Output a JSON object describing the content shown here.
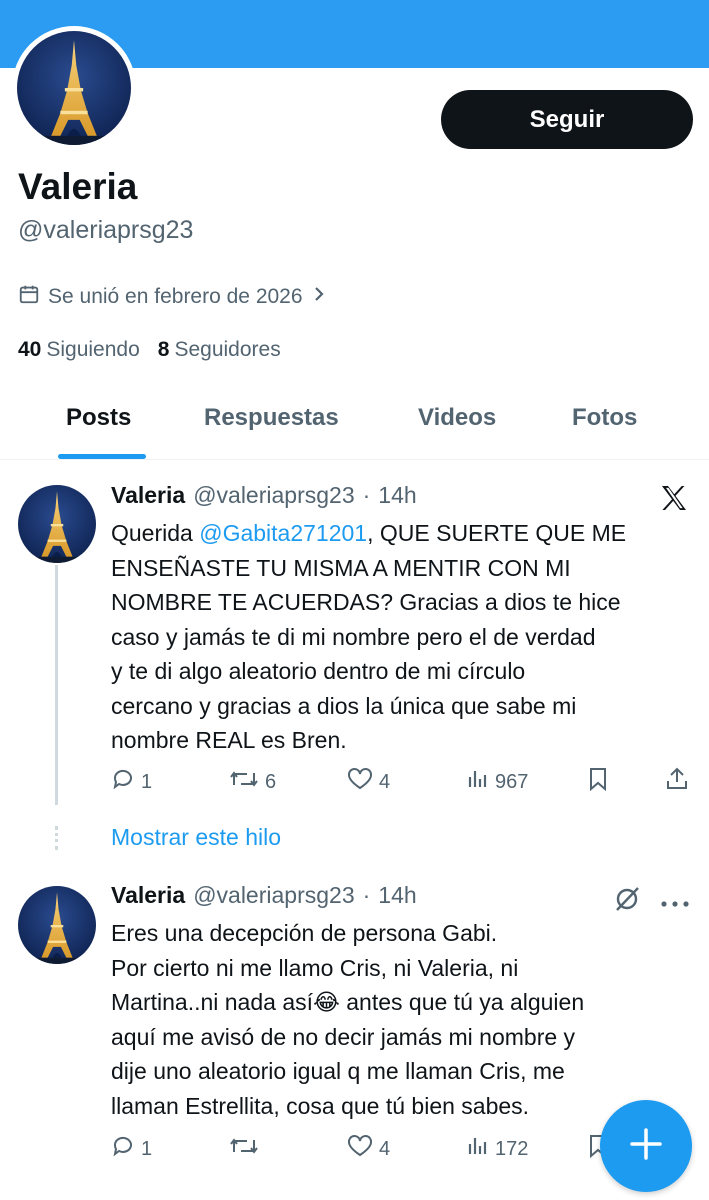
{
  "profile": {
    "name": "Valeria",
    "handle": "@valeriaprsg23",
    "joined": "Se unió en febrero de 2026",
    "following_count": "40",
    "following_label": "Siguiendo",
    "followers_count": "8",
    "followers_label": "Seguidores",
    "follow_button": "Seguir"
  },
  "tabs": [
    {
      "label": "Posts"
    },
    {
      "label": "Respuestas"
    },
    {
      "label": "Videos"
    },
    {
      "label": "Fotos"
    }
  ],
  "posts": [
    {
      "name": "Valeria",
      "handle": "@valeriaprsg23",
      "dot": "·",
      "time": "14h",
      "text_before": "Querida ",
      "mention": "@Gabita271201",
      "text_after": ", QUE SUERTE QUE ME\nENSEÑASTE TU MISMA A MENTIR CON MI\nNOMBRE TE ACUERDAS? Gracias a dios te hice\ncaso y jamás te di mi nombre pero el de verdad\ny te di algo aleatorio dentro de mi círculo\ncercano y gracias a dios la única que sabe mi\nnombre REAL es Bren.",
      "replies": "1",
      "reposts": "6",
      "likes": "4",
      "views": "967"
    },
    {
      "name": "Valeria",
      "handle": "@valeriaprsg23",
      "dot": "·",
      "time": "14h",
      "text": "Eres una decepción de persona Gabi.\nPor cierto ni me llamo Cris, ni Valeria, ni\nMartina..ni nada así😂 antes que tú ya alguien\naquí me avisó de no decir jamás mi nombre y\ndije uno aleatorio igual q me llaman Cris, me\nllaman Estrellita, cosa que tú bien sabes.",
      "replies": "1",
      "reposts": "",
      "likes": "4",
      "views": "172"
    }
  ],
  "show_thread": "Mostrar este hilo",
  "colors": {
    "banner": "#2b9cf1",
    "accent": "#1d9bf0",
    "text": "#0f1419",
    "muted": "#536471"
  },
  "icons": [
    "calendar-icon",
    "chevron-right-icon",
    "x-logo-icon",
    "reply-icon",
    "repost-icon",
    "like-icon",
    "views-icon",
    "bookmark-icon",
    "share-icon",
    "grok-icon",
    "more-icon",
    "plus-icon"
  ]
}
